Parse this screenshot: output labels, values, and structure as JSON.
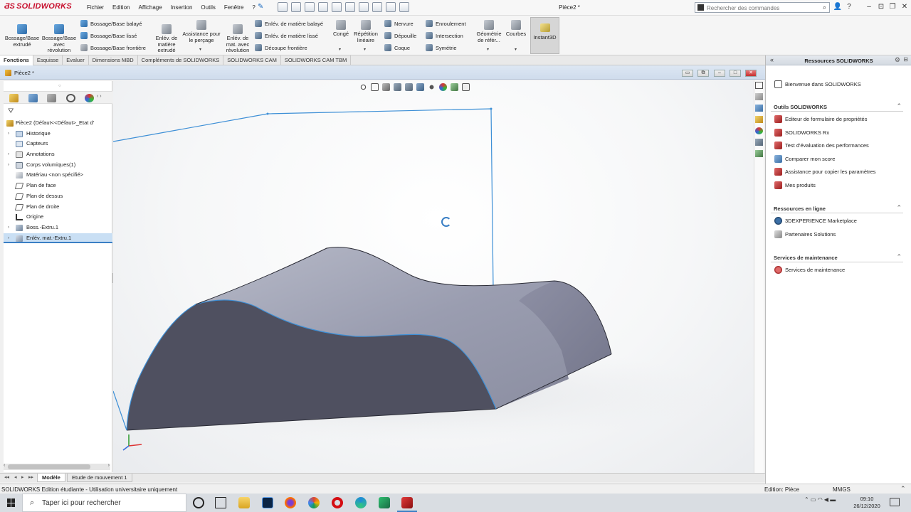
{
  "app": {
    "brand": "SOLIDWORKS",
    "doc_title": "Pièce2 *",
    "menus": [
      "Fichier",
      "Edition",
      "Affichage",
      "Insertion",
      "Outils",
      "Fenêtre",
      "?"
    ],
    "search_placeholder": "Rechercher des commandes"
  },
  "ribbon": {
    "bossage_extrude": "Bossage/Base extrudé",
    "bossage_revolution": "Bossage/Base avec révolution",
    "bossage_balaye": "Bossage/Base balayé",
    "bossage_lisse": "Bossage/Base lissé",
    "bossage_frontiere": "Bossage/Base frontière",
    "enlev_extrude": "Enlév. de matière extrudé",
    "assistance_percage": "Assistance pour le perçage",
    "enlev_revolution": "Enlév. de mat. avec révolution",
    "enlev_balaye": "Enlév. de matière balayé",
    "enlev_lisse": "Enlév. de matière lissé",
    "decoupe_frontiere": "Découpe frontière",
    "conge": "Congé",
    "repetition": "Répétition linéaire",
    "nervure": "Nervure",
    "depouille": "Dépouille",
    "coque": "Coque",
    "enroulement": "Enroulement",
    "intersection": "Intersection",
    "symetrie": "Symétrie",
    "geometrie_ref": "Géométrie de référ...",
    "courbes": "Courbes",
    "instant3d": "Instant3D"
  },
  "tabs": [
    "Fonctions",
    "Esquisse",
    "Evaluer",
    "Dimensions MBD",
    "Compléments de SOLIDWORKS",
    "SOLIDWORKS CAM",
    "SOLIDWORKS CAM TBM"
  ],
  "document": {
    "name": "Pièce2 *"
  },
  "tree": {
    "root": "Pièce2  (Défaut<<Défaut>_Etat d'",
    "items": [
      {
        "label": "Historique",
        "expandable": true
      },
      {
        "label": "Capteurs",
        "expandable": false
      },
      {
        "label": "Annotations",
        "expandable": true
      },
      {
        "label": "Corps volumiques(1)",
        "expandable": true
      },
      {
        "label": "Matériau <non spécifié>",
        "expandable": false
      },
      {
        "label": "Plan de face",
        "expandable": false
      },
      {
        "label": "Plan de dessus",
        "expandable": false
      },
      {
        "label": "Plan de droite",
        "expandable": false
      },
      {
        "label": "Origine",
        "expandable": false
      },
      {
        "label": "Boss.-Extru.1",
        "expandable": true
      },
      {
        "label": "Enlév. mat.-Extru.1",
        "expandable": true
      }
    ]
  },
  "bottom_tabs": [
    "Modèle",
    "Etude de mouvement 1"
  ],
  "taskpane": {
    "title": "Ressources SOLIDWORKS",
    "welcome": "Bienvenue dans SOLIDWORKS",
    "sections": [
      {
        "title": "Outils SOLIDWORKS",
        "items": [
          "Editeur de formulaire de propriétés",
          "SOLIDWORKS Rx",
          "Test d'évaluation des performances",
          "Comparer mon score",
          "Assistance pour copier les paramètres",
          "Mes produits"
        ]
      },
      {
        "title": "Ressources en ligne",
        "items": [
          "3DEXPERIENCE Marketplace",
          "Partenaires Solutions"
        ]
      },
      {
        "title": "Services de maintenance",
        "items": [
          "Services de maintenance"
        ]
      }
    ]
  },
  "status": {
    "left": "SOLIDWORKS Edition étudiante - Utilisation universitaire uniquement",
    "mode": "Edition: Pièce",
    "units": "MMGS"
  },
  "taskbar": {
    "search_text": "Taper ici pour rechercher",
    "time": "09:10",
    "date": "26/12/2020"
  }
}
